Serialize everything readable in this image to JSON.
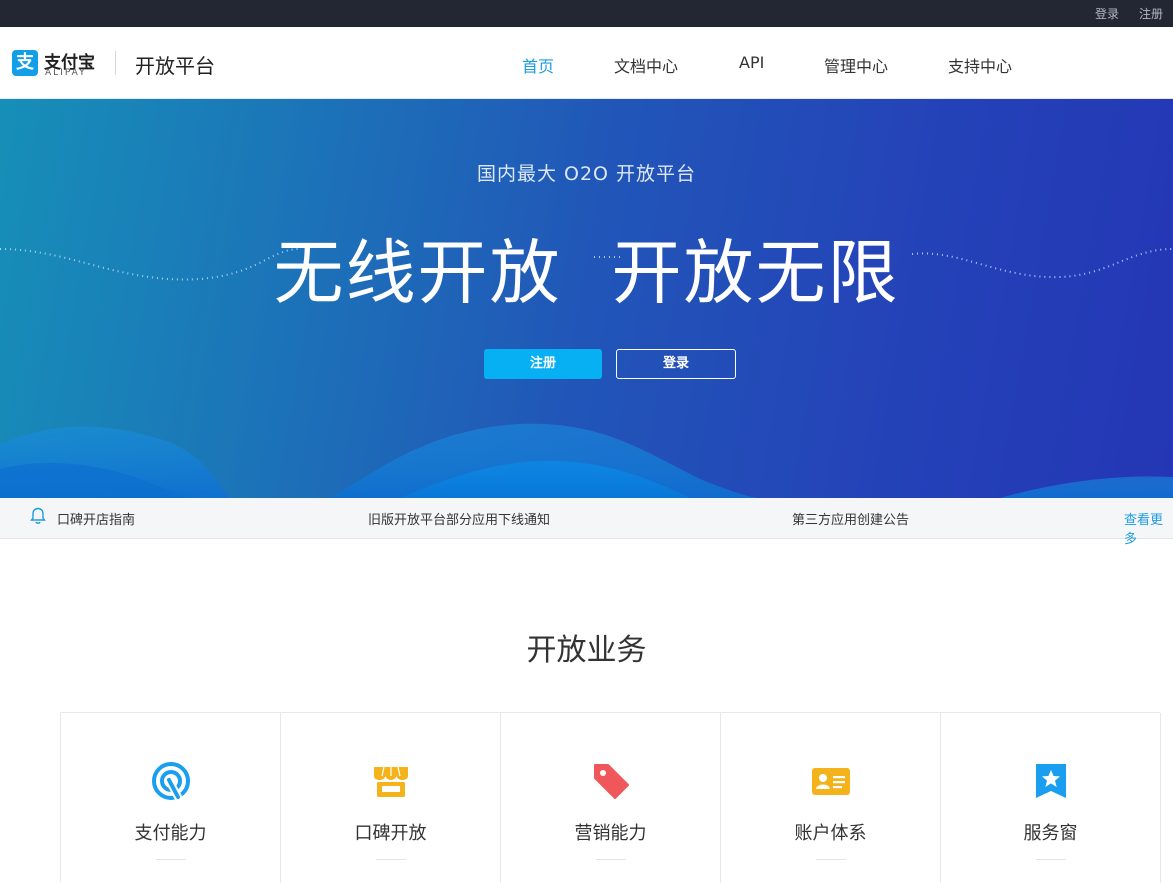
{
  "topbar": {
    "login": "登录",
    "register": "注册"
  },
  "header": {
    "logo_glyph": "支",
    "logo_cn": "支付宝",
    "logo_en": "ALIPAY",
    "platform_title": "开放平台",
    "nav": [
      "首页",
      "文档中心",
      "API",
      "管理中心",
      "支持中心"
    ],
    "active_nav": "首页"
  },
  "hero": {
    "subtitle": "国内最大 O2O 开放平台",
    "title_left": "无线开放",
    "title_right": "开放无限",
    "register_label": "注册",
    "login_label": "登录"
  },
  "notice": {
    "icon": "bell-icon",
    "items": [
      "口碑开店指南",
      "旧版开放平台部分应用下线通知",
      "第三方应用创建公告"
    ],
    "more": "查看更多"
  },
  "services": {
    "title": "开放业务",
    "items": [
      {
        "label": "支付能力",
        "icon": "payment-icon",
        "color": "#1a9ef0"
      },
      {
        "label": "口碑开放",
        "icon": "storefront-icon",
        "color": "#f5b31b"
      },
      {
        "label": "营销能力",
        "icon": "tag-icon",
        "color": "#f0575b"
      },
      {
        "label": "账户体系",
        "icon": "id-card-icon",
        "color": "#f5b31b"
      },
      {
        "label": "服务窗",
        "icon": "star-bookmark-icon",
        "color": "#1a9ef0"
      }
    ]
  },
  "colors": {
    "accent": "#1e9ce0",
    "topbar": "#232633",
    "hero_start": "#168fb8",
    "hero_end": "#2436b5",
    "button": "#07b0f2"
  }
}
